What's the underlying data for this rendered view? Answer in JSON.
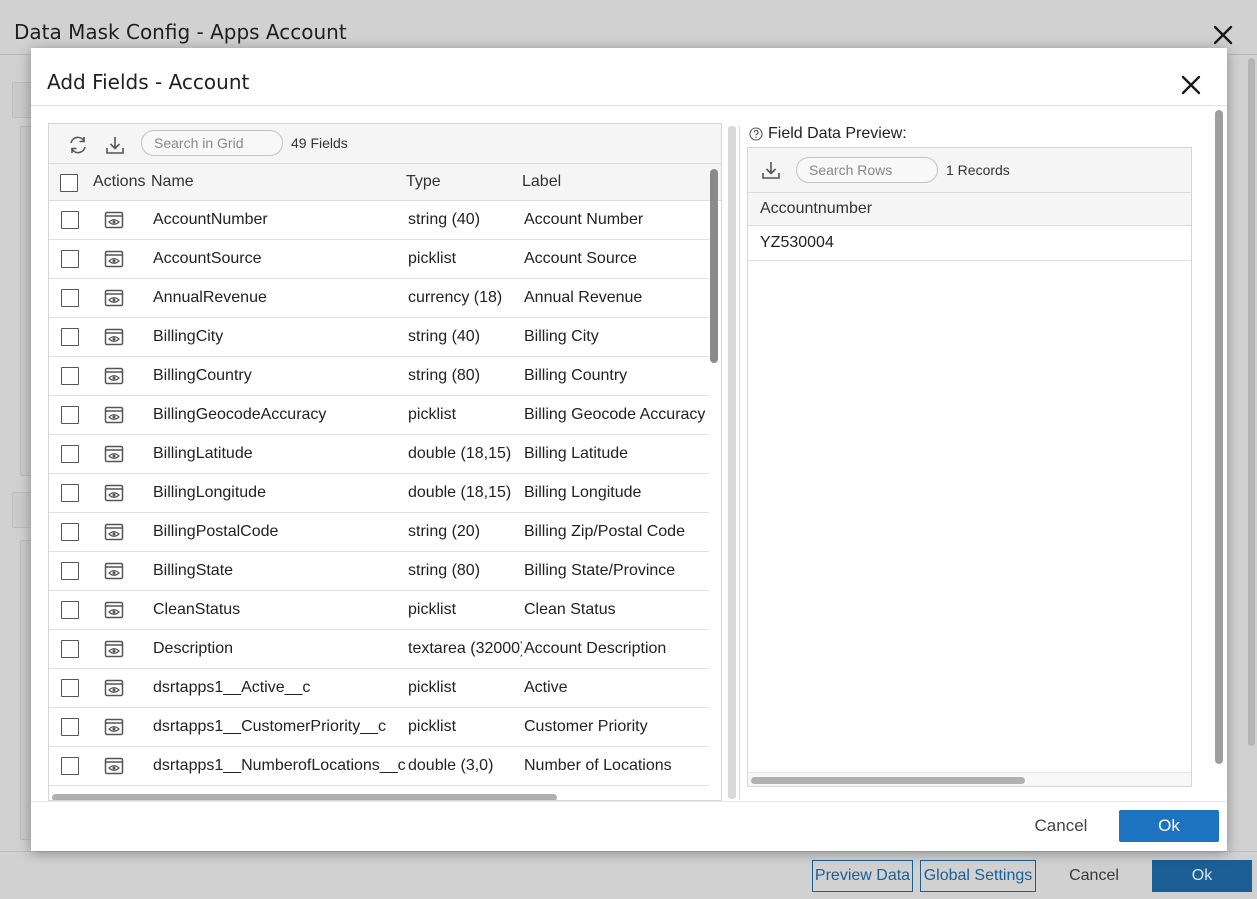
{
  "background": {
    "title": "Data Mask Config - Apps Account",
    "footer": {
      "preview_data": "Preview Data",
      "global_settings": "Global Settings",
      "cancel": "Cancel",
      "ok": "Ok"
    }
  },
  "modal": {
    "title": "Add Fields - Account",
    "grid": {
      "search_placeholder": "Search in Grid",
      "count": "49 Fields",
      "columns": {
        "actions": "Actions",
        "name": "Name",
        "type": "Type",
        "label": "Label"
      },
      "rows": [
        {
          "name": "AccountNumber",
          "type": "string (40)",
          "label": "Account Number"
        },
        {
          "name": "AccountSource",
          "type": "picklist",
          "label": "Account Source"
        },
        {
          "name": "AnnualRevenue",
          "type": "currency (18)",
          "label": "Annual Revenue"
        },
        {
          "name": "BillingCity",
          "type": "string (40)",
          "label": "Billing City"
        },
        {
          "name": "BillingCountry",
          "type": "string (80)",
          "label": "Billing Country"
        },
        {
          "name": "BillingGeocodeAccuracy",
          "type": "picklist",
          "label": "Billing Geocode Accuracy"
        },
        {
          "name": "BillingLatitude",
          "type": "double (18,15)",
          "label": "Billing Latitude"
        },
        {
          "name": "BillingLongitude",
          "type": "double (18,15)",
          "label": "Billing Longitude"
        },
        {
          "name": "BillingPostalCode",
          "type": "string (20)",
          "label": "Billing Zip/Postal Code"
        },
        {
          "name": "BillingState",
          "type": "string (80)",
          "label": "Billing State/Province"
        },
        {
          "name": "CleanStatus",
          "type": "picklist",
          "label": "Clean Status"
        },
        {
          "name": "Description",
          "type": "textarea (32000)",
          "label": "Account Description"
        },
        {
          "name": "dsrtapps1__Active__c",
          "type": "picklist",
          "label": "Active"
        },
        {
          "name": "dsrtapps1__CustomerPriority__c",
          "type": "picklist",
          "label": "Customer Priority"
        },
        {
          "name": "dsrtapps1__NumberofLocations__c",
          "type": "double (3,0)",
          "label": "Number of Locations"
        }
      ]
    },
    "preview": {
      "label": "Field Data Preview:",
      "search_placeholder": "Search Rows",
      "count": "1 Records",
      "column": "Accountnumber",
      "rows": [
        "YZ530004"
      ]
    },
    "footer": {
      "cancel": "Cancel",
      "ok": "Ok"
    }
  },
  "icons": {
    "refresh": "refresh-icon",
    "download": "download-icon",
    "preview": "eye-icon",
    "help": "help-icon",
    "close": "close-icon"
  },
  "colors": {
    "primary": "#1d73c0",
    "primary_dimmed": "#1b5f95"
  }
}
